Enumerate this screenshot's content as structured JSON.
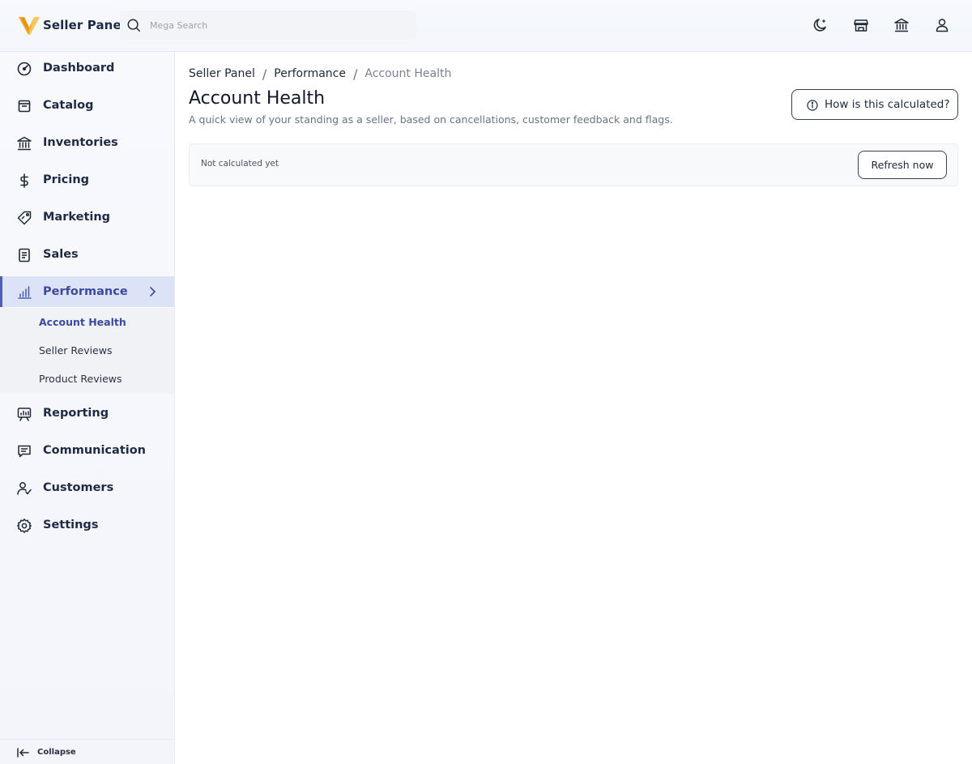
{
  "brand": {
    "name": "Seller Panel",
    "colors": {
      "logo_primary": "#f5a623",
      "logo_secondary": "#f8c75a",
      "accent": "#4f5fb8"
    }
  },
  "search": {
    "placeholder": "Mega Search",
    "value": ""
  },
  "header_actions": [
    {
      "icon": "moon-icon"
    },
    {
      "icon": "storefront-icon"
    },
    {
      "icon": "bank-icon"
    },
    {
      "icon": "user-icon"
    }
  ],
  "sidebar": {
    "items": [
      {
        "label": "Dashboard",
        "icon": "dashboard-icon"
      },
      {
        "label": "Catalog",
        "icon": "catalog-icon"
      },
      {
        "label": "Inventories",
        "icon": "warehouse-icon"
      },
      {
        "label": "Pricing",
        "icon": "dollar-icon"
      },
      {
        "label": "Marketing",
        "icon": "tag-icon"
      },
      {
        "label": "Sales",
        "icon": "receipt-icon"
      },
      {
        "label": "Performance",
        "icon": "bar-chart-icon",
        "active": true
      },
      {
        "label": "Reporting",
        "icon": "report-icon"
      },
      {
        "label": "Communication",
        "icon": "chat-icon"
      },
      {
        "label": "Customers",
        "icon": "customers-icon"
      },
      {
        "label": "Settings",
        "icon": "gear-icon"
      }
    ],
    "submenu": [
      {
        "label": "Account Health",
        "current": true
      },
      {
        "label": "Seller Reviews"
      },
      {
        "label": "Product Reviews"
      }
    ],
    "collapse_label": "Collapse"
  },
  "breadcrumb": {
    "root": "Seller Panel",
    "section": "Performance",
    "current": "Account Health",
    "separator": "/"
  },
  "page": {
    "title": "Account Health",
    "subtitle": "A quick view of your standing as a seller, based on cancellations, customer feedback and flags.",
    "how_button": "How is this calculated?",
    "status_text": "Not calculated yet",
    "refresh_button": "Refresh now"
  }
}
